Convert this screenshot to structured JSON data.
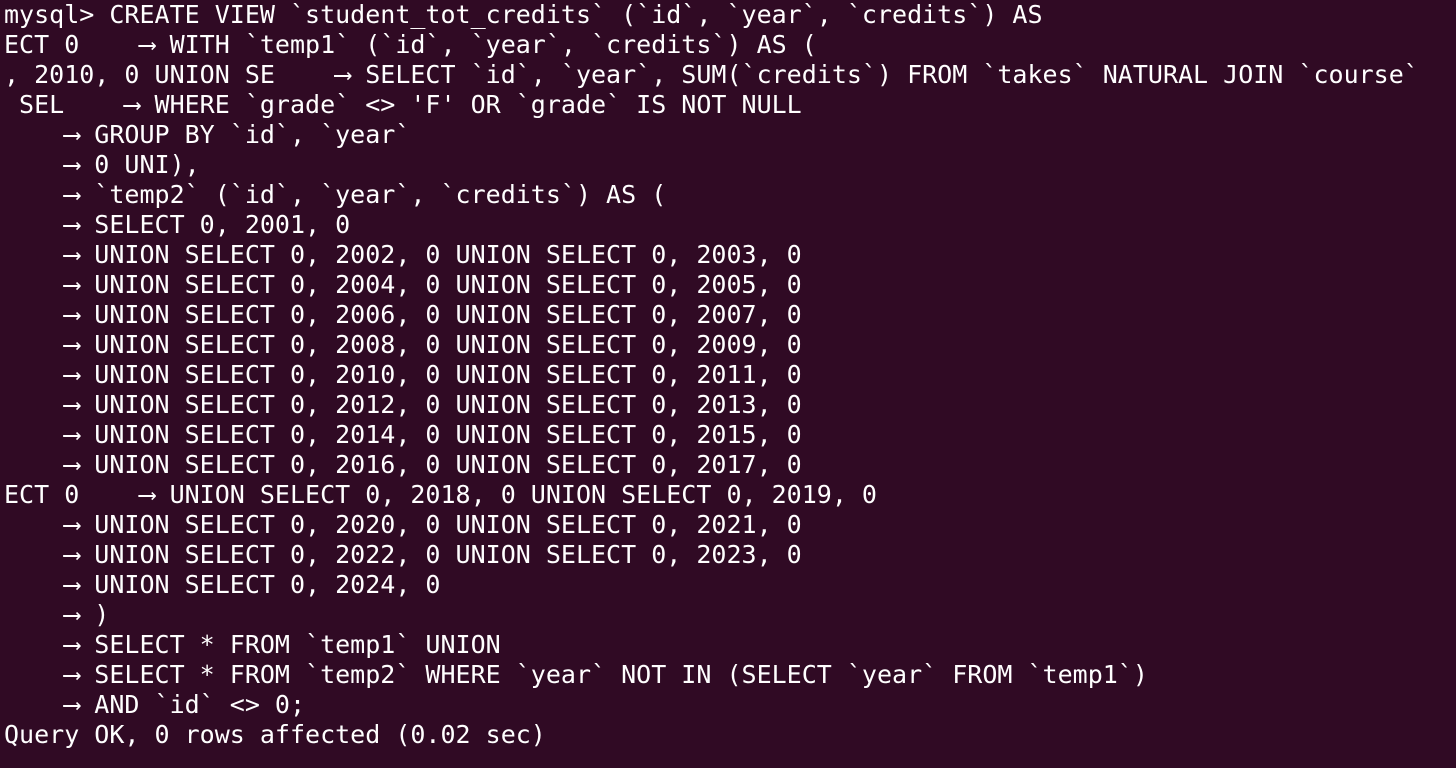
{
  "terminal": {
    "colors": {
      "background": "#300a24",
      "foreground": "#ffffff"
    },
    "lines": [
      "mysql> CREATE VIEW `student_tot_credits` (`id`, `year`, `credits`) AS",
      "ECT 0    ⟶ WITH `temp1` (`id`, `year`, `credits`) AS (",
      ", 2010, 0 UNION SE    ⟶ SELECT `id`, `year`, SUM(`credits`) FROM `takes` NATURAL JOIN `course`",
      " SEL    ⟶ WHERE `grade` <> 'F' OR `grade` IS NOT NULL",
      "    ⟶ GROUP BY `id`, `year`",
      "    ⟶ 0 UNI),",
      "    ⟶ `temp2` (`id`, `year`, `credits`) AS (",
      "    ⟶ SELECT 0, 2001, 0",
      "    ⟶ UNION SELECT 0, 2002, 0 UNION SELECT 0, 2003, 0",
      "    ⟶ UNION SELECT 0, 2004, 0 UNION SELECT 0, 2005, 0",
      "    ⟶ UNION SELECT 0, 2006, 0 UNION SELECT 0, 2007, 0",
      "    ⟶ UNION SELECT 0, 2008, 0 UNION SELECT 0, 2009, 0",
      "    ⟶ UNION SELECT 0, 2010, 0 UNION SELECT 0, 2011, 0",
      "    ⟶ UNION SELECT 0, 2012, 0 UNION SELECT 0, 2013, 0",
      "    ⟶ UNION SELECT 0, 2014, 0 UNION SELECT 0, 2015, 0",
      "    ⟶ UNION SELECT 0, 2016, 0 UNION SELECT 0, 2017, 0",
      "ECT 0    ⟶ UNION SELECT 0, 2018, 0 UNION SELECT 0, 2019, 0",
      "    ⟶ UNION SELECT 0, 2020, 0 UNION SELECT 0, 2021, 0",
      "    ⟶ UNION SELECT 0, 2022, 0 UNION SELECT 0, 2023, 0",
      "    ⟶ UNION SELECT 0, 2024, 0",
      "    ⟶ )",
      "    ⟶ SELECT * FROM `temp1` UNION",
      "    ⟶ SELECT * FROM `temp2` WHERE `year` NOT IN (SELECT `year` FROM `temp1`)",
      "    ⟶ AND `id` <> 0;",
      "Query OK, 0 rows affected (0.02 sec)"
    ]
  }
}
